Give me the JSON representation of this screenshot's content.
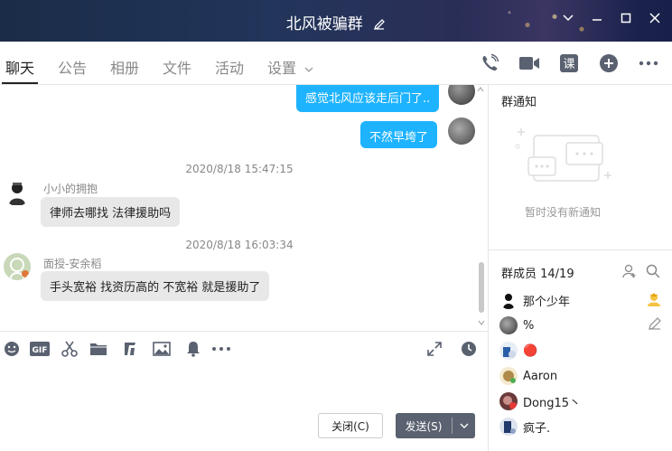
{
  "window": {
    "title": "北风被骗群"
  },
  "tabs": [
    {
      "label": "聊天"
    },
    {
      "label": "公告"
    },
    {
      "label": "相册"
    },
    {
      "label": "文件"
    },
    {
      "label": "活动"
    },
    {
      "label": "设置"
    }
  ],
  "tab_icons": [
    "phone-icon",
    "video-icon",
    "course-icon",
    "add-icon",
    "more-icon"
  ],
  "messages": {
    "m1": {
      "text": "感觉北风应该走后门了.."
    },
    "m2": {
      "text": "不然早垮了"
    },
    "t1": "2020/8/18 15:47:15",
    "m3": {
      "sender": "小小的拥抱",
      "text": "律师去哪找 法律援助吗"
    },
    "t2": "2020/8/18 16:03:34",
    "m4": {
      "sender": "面授-安余稻",
      "text": "手头宽裕  找资历高的    不宽裕  就是援助了"
    }
  },
  "toolbar": {
    "icons": [
      "emoji-icon",
      "gif-icon",
      "scissors-icon",
      "folder-icon",
      "music-icon",
      "image-icon",
      "bell-icon",
      "more-icon",
      "expand-icon",
      "history-icon"
    ],
    "gif_label": "GIF"
  },
  "actions": {
    "close_label": "关闭(C)",
    "send_label": "发送(S)"
  },
  "right_panel": {
    "notice_title": "群通知",
    "notice_empty": "暂时没有新通知",
    "members_title": "群成员 14/19",
    "members": [
      {
        "name": "那个少年"
      },
      {
        "name": "%"
      },
      {
        "name": "🔴"
      },
      {
        "name": "Aaron"
      },
      {
        "name": "Dong15丶"
      },
      {
        "name": "疯子."
      }
    ]
  },
  "colors": {
    "accent_blue": "#1eb3ff",
    "bubble_gray": "#e8e8e8",
    "send_button": "#5a6170"
  }
}
